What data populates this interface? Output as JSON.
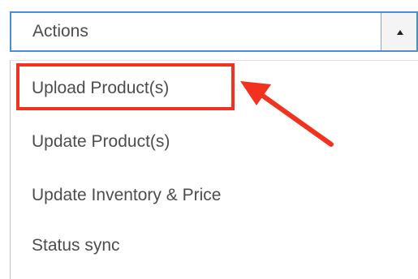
{
  "select": {
    "value": "Actions",
    "toggle_icon": "caret-up-icon"
  },
  "dropdown": {
    "options": [
      {
        "label": "Upload Product(s)",
        "highlighted": true
      },
      {
        "label": "Update Product(s)"
      },
      {
        "label": "Update Inventory & Price"
      },
      {
        "label": "Status sync"
      }
    ]
  },
  "annotation": {
    "color": "#f0321e",
    "arrow_icon": "arrow-icon"
  },
  "colors": {
    "select_border": "#4a8fd0",
    "text": "#4d4d4d"
  }
}
